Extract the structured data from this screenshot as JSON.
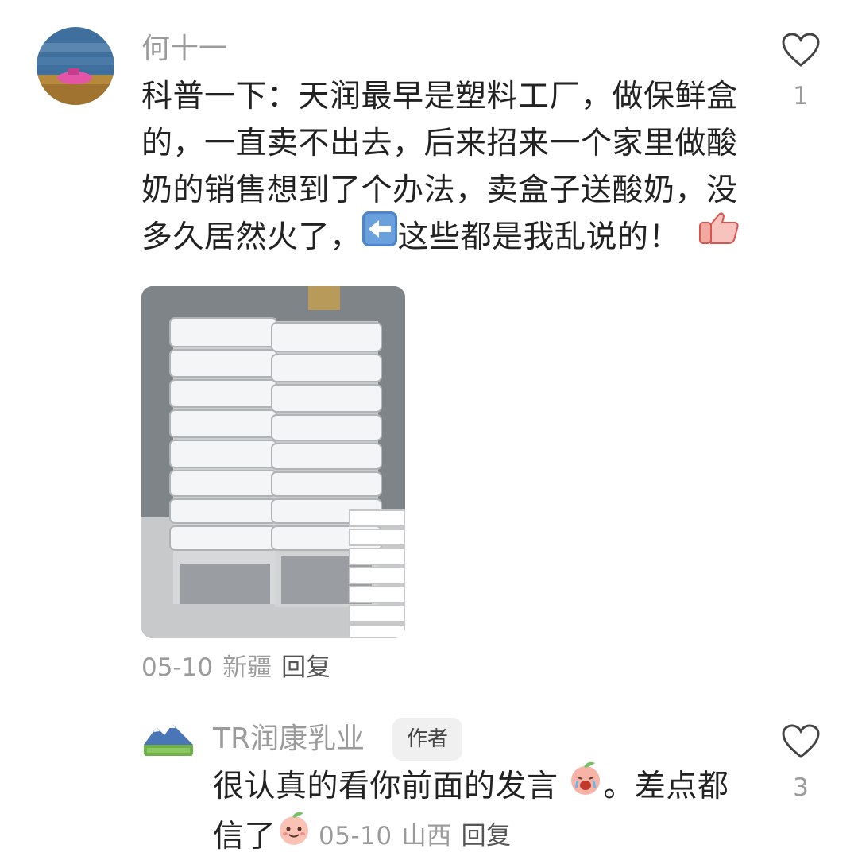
{
  "comment": {
    "username": "何十一",
    "text_lines": [
      "科普一下：天润最早是塑料工厂，做保鲜盒",
      "的，一直卖不出去，后来招来一个家里做酸",
      "奶的销售想到了个办法，卖盒子送酸奶，没"
    ],
    "last_line_before": "多久居然火了，",
    "left_arrow_icon": "left-arrow-emoji-icon",
    "last_line_after": "这些都是我乱说的！",
    "thumbs_icon": "thumbs-up-emoji-icon",
    "date": "05-10",
    "region": "新疆",
    "reply_label": "回复",
    "like_count": "1",
    "photo_subject": "stacked plastic food containers"
  },
  "reply": {
    "username": "TR润康乳业",
    "badge": "作者",
    "line1_before": "很认真的看你前面的发言",
    "line1_emoji": "crying-peach-emoji-icon",
    "line1_after": "。差点都",
    "line2_before": "信了",
    "line2_emoji": "smiling-peach-emoji-icon",
    "date": "05-10",
    "region": "山西",
    "reply_label": "回复",
    "like_count": "3"
  },
  "colors": {
    "text": "#222222",
    "muted": "#9b9b9b",
    "badge_bg": "#f0f0f0"
  }
}
